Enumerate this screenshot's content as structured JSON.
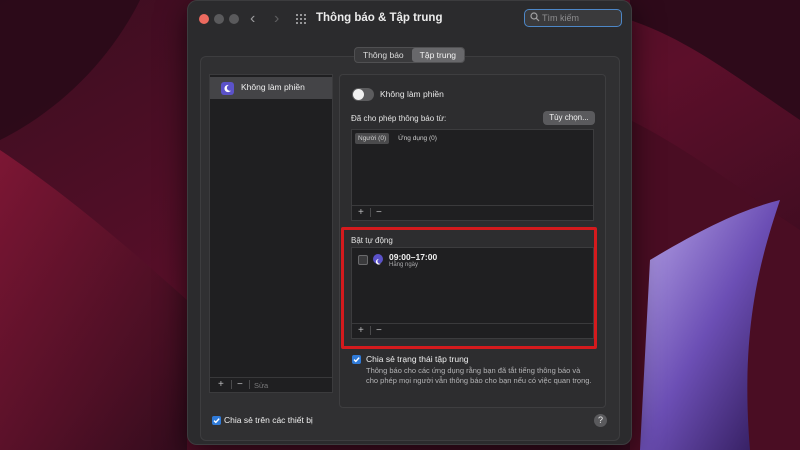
{
  "window": {
    "title": "Thông báo & Tập trung",
    "search_placeholder": "Tìm kiếm"
  },
  "tabs": [
    {
      "label": "Thông báo",
      "active": false
    },
    {
      "label": "Tập trung",
      "active": true
    }
  ],
  "sidebar": {
    "items": [
      {
        "label": "Không làm phiền",
        "icon": "moon-icon"
      }
    ],
    "footer": {
      "add": "+",
      "remove": "−",
      "edit": "Sửa"
    }
  },
  "panel": {
    "toggle_label": "Không làm phiền",
    "toggle_on": false,
    "allowed_label": "Đã cho phép thông báo từ:",
    "custom_button": "Tùy chọn...",
    "allowed_tabs": [
      {
        "label": "Người (0)",
        "active": true
      },
      {
        "label": "Ứng dụng (0)",
        "active": false
      }
    ],
    "allowed_footer": {
      "add": "+",
      "remove": "−"
    },
    "auto_label": "Bật tự động",
    "schedule": {
      "time": "09:00–17:00",
      "repeat": "Hằng ngày",
      "checked": false
    },
    "schedule_footer": {
      "add": "+",
      "remove": "−"
    },
    "share_label": "Chia sẻ trạng thái tập trung",
    "share_checked": true,
    "share_description": "Thông báo cho các ứng dụng rằng bạn đã tắt tiếng thông báo và cho phép mọi người vẫn thông báo cho bạn nếu có việc quan trọng."
  },
  "footer": {
    "share_all_label": "Chia sẻ trên các thiết bị",
    "share_all_checked": true,
    "help": "?"
  },
  "colors": {
    "accent": "#2f7ad8",
    "focus_purple": "#5b52c9",
    "highlight_red": "#d41a1d"
  }
}
